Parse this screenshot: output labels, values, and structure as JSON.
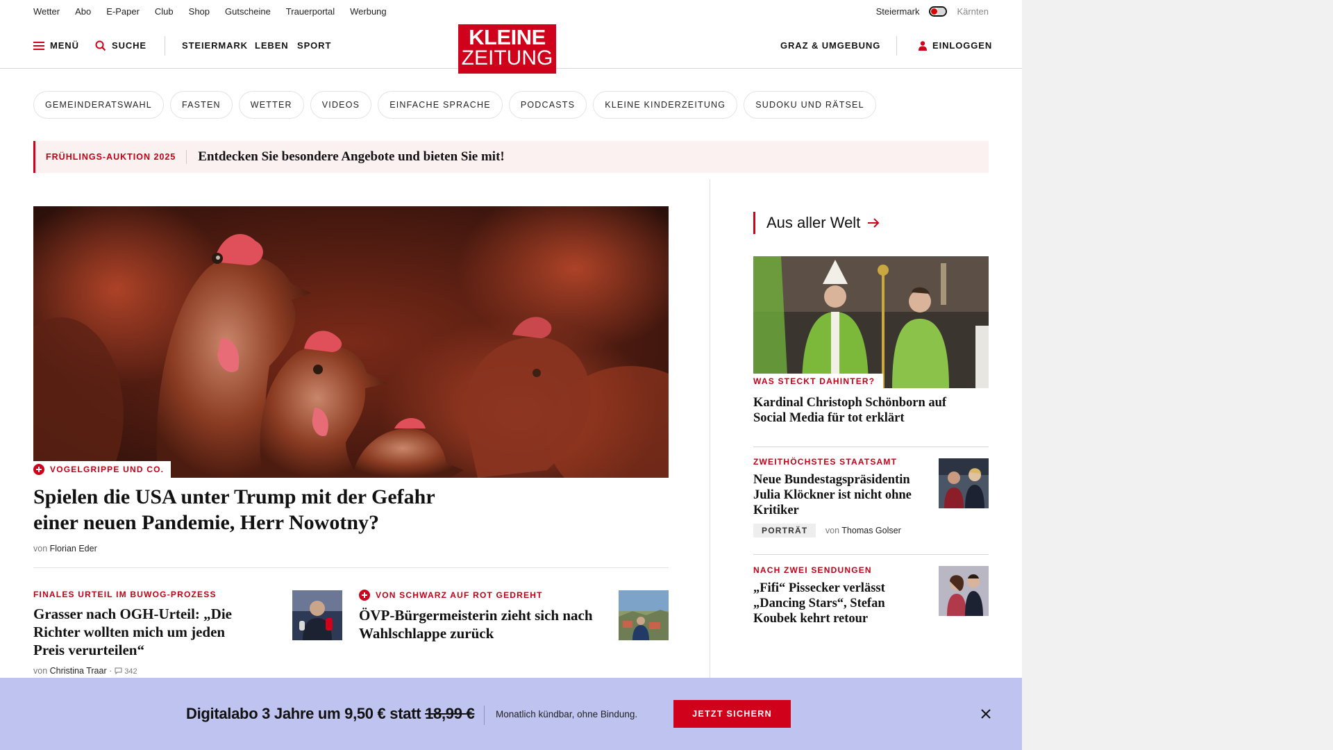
{
  "utility_nav": {
    "links": [
      "Wetter",
      "Abo",
      "E-Paper",
      "Club",
      "Shop",
      "Gutscheine",
      "Trauerportal",
      "Werbung"
    ],
    "region_active": "Steiermark",
    "region_inactive": "Kärnten"
  },
  "header": {
    "menu_label": "MENÜ",
    "search_label": "SUCHE",
    "sections": [
      "STEIERMARK",
      "LEBEN",
      "SPORT"
    ],
    "logo_line1": "KLEINE",
    "logo_line2": "ZEITUNG",
    "region_label": "GRAZ & UMGEBUNG",
    "login_label": "EINLOGGEN"
  },
  "topic_pills": [
    "GEMEINDERATSWAHL",
    "FASTEN",
    "WETTER",
    "VIDEOS",
    "EINFACHE SPRACHE",
    "PODCASTS",
    "KLEINE KINDERZEITUNG",
    "SUDOKU UND RÄTSEL"
  ],
  "promo": {
    "tag": "FRÜHLINGS-AUKTION 2025",
    "text": "Entdecken Sie besondere Angebote und bieten Sie mit!"
  },
  "hero": {
    "kicker": "VOGELGRIPPE UND CO.",
    "title": "Spielen die USA unter Trump mit der Gefahr einer neuen Pandemie, Herr Nowotny?",
    "byline_prefix": "von",
    "author": "Florian Eder"
  },
  "teasers": [
    {
      "kicker": "FINALES URTEIL IM BUWOG-PROZESS",
      "title": "Grasser nach OGH-Urteil: „Die Richter wollten mich um jeden Preis verurteilen“",
      "byline_prefix": "von",
      "author": "Christina Traar",
      "comments": "342"
    },
    {
      "kicker": "VON SCHWARZ AUF ROT GEDREHT",
      "title": "ÖVP-Bürgermeisterin zieht sich nach Wahlschlappe zurück"
    }
  ],
  "sidebar": {
    "heading": "Aus aller Welt",
    "lead": {
      "kicker": "WAS STECKT DAHINTER?",
      "title": "Kardinal Christoph Schönborn auf Social Media für tot erklärt"
    },
    "items": [
      {
        "kicker": "ZWEITHÖCHSTES STAATSAMT",
        "title": "Neue Bundestagspräsidentin Julia Klöckner ist nicht ohne Kritiker",
        "badge": "PORTRÄT",
        "byline_prefix": "von",
        "author": "Thomas Golser"
      },
      {
        "kicker": "NACH ZWEI SENDUNGEN",
        "title": "„Fifi“ Pissecker verlässt „Dancing Stars“, Stefan Koubek kehrt retour"
      }
    ]
  },
  "banner": {
    "headline": "Digitalabo 3 Jahre um 9,50 € statt",
    "old_price": "18,99 €",
    "subtext": "Monatlich kündbar, ohne Bindung.",
    "cta": "JETZT SICHERN"
  },
  "colors": {
    "brand_red": "#d0021b",
    "banner_bg": "#bfc3ef",
    "promo_bg": "#fcf1f1"
  }
}
